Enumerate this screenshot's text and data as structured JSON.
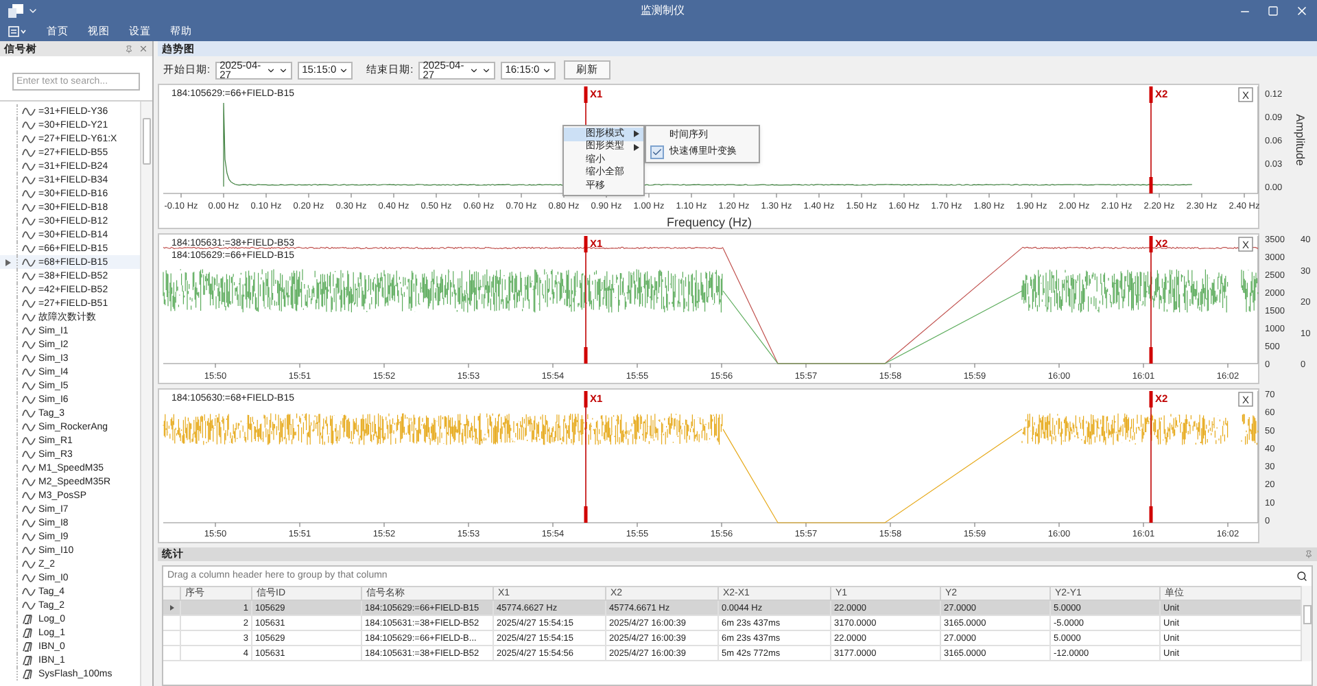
{
  "window": {
    "title": "监测制仪"
  },
  "menu": [
    "首页",
    "视图",
    "设置",
    "帮助"
  ],
  "signal_tree": {
    "title": "信号树",
    "search": {
      "placeholder": "Enter text to search..."
    },
    "items": [
      {
        "label": "=31+FIELD-Y36",
        "kind": "analog",
        "selected": false
      },
      {
        "label": "=30+FIELD-Y21",
        "kind": "analog",
        "selected": false
      },
      {
        "label": "=27+FIELD-Y61:X",
        "kind": "analog",
        "selected": false
      },
      {
        "label": "=27+FIELD-B55",
        "kind": "analog",
        "selected": false
      },
      {
        "label": "=31+FIELD-B24",
        "kind": "analog",
        "selected": false
      },
      {
        "label": "=31+FIELD-B34",
        "kind": "analog",
        "selected": false
      },
      {
        "label": "=30+FIELD-B16",
        "kind": "analog",
        "selected": false
      },
      {
        "label": "=30+FIELD-B18",
        "kind": "analog",
        "selected": false
      },
      {
        "label": "=30+FIELD-B12",
        "kind": "analog",
        "selected": false
      },
      {
        "label": "=30+FIELD-B14",
        "kind": "analog",
        "selected": false
      },
      {
        "label": "=66+FIELD-B15",
        "kind": "analog",
        "selected": false
      },
      {
        "label": "=68+FIELD-B15",
        "kind": "analog",
        "selected": true
      },
      {
        "label": "=38+FIELD-B52",
        "kind": "analog",
        "selected": false
      },
      {
        "label": "=42+FIELD-B52",
        "kind": "analog",
        "selected": false
      },
      {
        "label": "=27+FIELD-B51",
        "kind": "analog",
        "selected": false
      },
      {
        "label": "故障次数计数",
        "kind": "analog",
        "selected": false
      },
      {
        "label": "Sim_I1",
        "kind": "analog",
        "selected": false
      },
      {
        "label": "Sim_I2",
        "kind": "analog",
        "selected": false
      },
      {
        "label": "Sim_I3",
        "kind": "analog",
        "selected": false
      },
      {
        "label": "Sim_I4",
        "kind": "analog",
        "selected": false
      },
      {
        "label": "Sim_I5",
        "kind": "analog",
        "selected": false
      },
      {
        "label": "Sim_I6",
        "kind": "analog",
        "selected": false
      },
      {
        "label": "Tag_3",
        "kind": "analog",
        "selected": false
      },
      {
        "label": "Sim_RockerAng",
        "kind": "analog",
        "selected": false
      },
      {
        "label": "Sim_R1",
        "kind": "analog",
        "selected": false
      },
      {
        "label": "Sim_R3",
        "kind": "analog",
        "selected": false
      },
      {
        "label": "M1_SpeedM35",
        "kind": "analog",
        "selected": false
      },
      {
        "label": "M2_SpeedM35R",
        "kind": "analog",
        "selected": false
      },
      {
        "label": "M3_PosSP",
        "kind": "analog",
        "selected": false
      },
      {
        "label": "Sim_I7",
        "kind": "analog",
        "selected": false
      },
      {
        "label": "Sim_I8",
        "kind": "analog",
        "selected": false
      },
      {
        "label": "Sim_I9",
        "kind": "analog",
        "selected": false
      },
      {
        "label": "Sim_I10",
        "kind": "analog",
        "selected": false
      },
      {
        "label": "Z_2",
        "kind": "analog",
        "selected": false
      },
      {
        "label": "Sim_I0",
        "kind": "analog",
        "selected": false
      },
      {
        "label": "Tag_4",
        "kind": "analog",
        "selected": false
      },
      {
        "label": "Tag_2",
        "kind": "analog",
        "selected": false
      },
      {
        "label": "Log_0",
        "kind": "digital",
        "selected": false
      },
      {
        "label": "Log_1",
        "kind": "digital",
        "selected": false
      },
      {
        "label": "IBN_0",
        "kind": "digital",
        "selected": false
      },
      {
        "label": "IBN_1",
        "kind": "digital",
        "selected": false
      },
      {
        "label": "SysFlash_100ms",
        "kind": "digital",
        "selected": false
      }
    ]
  },
  "trend": {
    "title": "趋势图",
    "start_label": "开始日期:",
    "start_date": "2025-04-27",
    "start_time": "15:15:0",
    "end_label": "结束日期:",
    "end_date": "2025-04-27",
    "end_time": "16:15:0",
    "refresh": "刷新",
    "charts": [
      {
        "kind": "fft",
        "series": [
          {
            "name": "184:105629:=66+FIELD-B15",
            "color": "#3a7d3a",
            "kind": "spike"
          }
        ],
        "xticks": [
          "-0.10 Hz",
          "0.00 Hz",
          "0.10 Hz",
          "0.20 Hz",
          "0.30 Hz",
          "0.40 Hz",
          "0.50 Hz",
          "0.60 Hz",
          "0.70 Hz",
          "0.80 Hz",
          "0.90 Hz",
          "1.00 Hz",
          "1.10 Hz",
          "1.20 Hz",
          "1.30 Hz",
          "1.40 Hz",
          "1.50 Hz",
          "1.60 Hz",
          "1.70 Hz",
          "1.80 Hz",
          "1.90 Hz",
          "2.00 Hz",
          "2.10 Hz",
          "2.20 Hz",
          "2.30 Hz",
          "2.40 Hz"
        ],
        "xlabel": "Frequency (Hz)",
        "yticks": [
          "0.12",
          "0.09",
          "0.06",
          "0.03",
          "0.00"
        ],
        "ylabel": "Amplitude",
        "cursors": [
          "X1",
          "X2"
        ],
        "close": "X"
      },
      {
        "kind": "time",
        "series": [
          {
            "name": "184:105631:=38+FIELD-B53",
            "color": "#c0504d",
            "kind": "flat"
          },
          {
            "name": "184:105629:=66+FIELD-B15",
            "color": "#5aab5a",
            "kind": "noise"
          }
        ],
        "xticks": [
          "15:50",
          "15:51",
          "15:52",
          "15:53",
          "15:54",
          "15:55",
          "15:56",
          "15:57",
          "15:58",
          "15:59",
          "16:00",
          "16:01",
          "16:02"
        ],
        "yticks": [
          "3500",
          "3000",
          "2500",
          "2000",
          "1500",
          "1000",
          "500",
          "0"
        ],
        "yticks2": [
          "40",
          "30",
          "20",
          "10",
          "0"
        ],
        "cursors": [
          "X1",
          "X2"
        ],
        "close": "X"
      },
      {
        "kind": "time",
        "series": [
          {
            "name": "184:105630:=68+FIELD-B15",
            "color": "#e6a817",
            "kind": "noise-high"
          }
        ],
        "xticks": [
          "15:50",
          "15:51",
          "15:52",
          "15:53",
          "15:54",
          "15:55",
          "15:56",
          "15:57",
          "15:58",
          "15:59",
          "16:00",
          "16:01",
          "16:02"
        ],
        "yticks": [
          "70",
          "60",
          "50",
          "40",
          "30",
          "20",
          "10",
          "0"
        ],
        "cursors": [
          "X1",
          "X2"
        ],
        "close": "X"
      }
    ],
    "context_menu": {
      "items": [
        {
          "label": "图形模式",
          "submenu": true,
          "selected": true
        },
        {
          "label": "图形类型",
          "submenu": true,
          "selected": false
        },
        {
          "label": "缩小",
          "submenu": false,
          "selected": false
        },
        {
          "label": "缩小全部",
          "submenu": false,
          "selected": false
        },
        {
          "label": "平移",
          "submenu": false,
          "selected": false
        }
      ],
      "submenu": [
        {
          "label": "时间序列",
          "checked": false
        },
        {
          "label": "快速傅里叶变换",
          "checked": true
        }
      ]
    }
  },
  "statistics": {
    "title": "统计",
    "group_hint": "Drag a column header here to group by that column",
    "columns": [
      "序号",
      "信号ID",
      "信号名称",
      "X1",
      "X2",
      "X2-X1",
      "Y1",
      "Y2",
      "Y2-Y1",
      "单位"
    ],
    "rows": [
      {
        "selected": true,
        "cells": [
          "1",
          "105629",
          "184:105629:=66+FIELD-B15",
          "45774.6627 Hz",
          "45774.6671 Hz",
          "0.0044 Hz",
          "22.0000",
          "27.0000",
          "5.0000",
          "Unit"
        ]
      },
      {
        "selected": false,
        "cells": [
          "2",
          "105631",
          "184:105631:=38+FIELD-B52",
          "2025/4/27 15:54:15",
          "2025/4/27 16:00:39",
          "6m 23s 437ms",
          "3170.0000",
          "3165.0000",
          "-5.0000",
          "Unit"
        ]
      },
      {
        "selected": false,
        "cells": [
          "3",
          "105629",
          "184:105629:=66+FIELD-B...",
          "2025/4/27 15:54:15",
          "2025/4/27 16:00:39",
          "6m 23s 437ms",
          "22.0000",
          "27.0000",
          "5.0000",
          "Unit"
        ]
      },
      {
        "selected": false,
        "cells": [
          "4",
          "105631",
          "184:105631:=38+FIELD-B52",
          "2025/4/27 15:54:56",
          "2025/4/27 16:00:39",
          "5m 42s 772ms",
          "3177.0000",
          "3165.0000",
          "-12.0000",
          "Unit"
        ]
      }
    ]
  }
}
